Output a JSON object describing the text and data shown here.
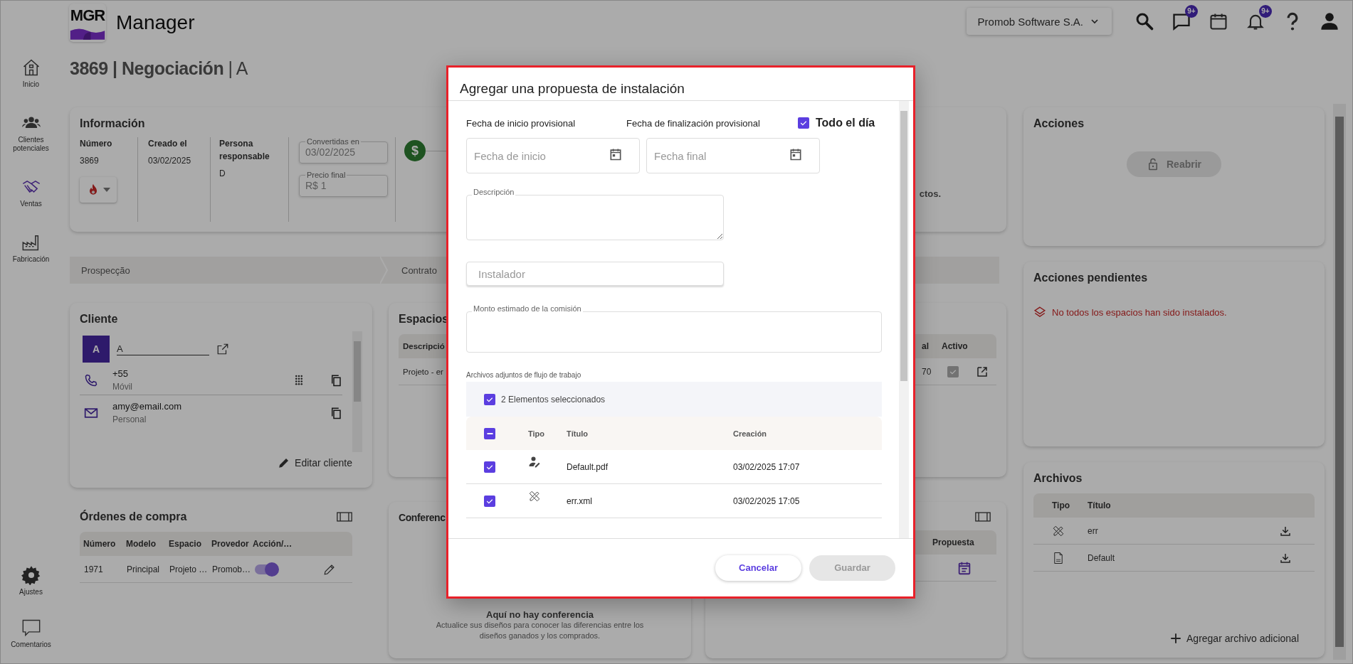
{
  "header": {
    "logo_text": "MGR",
    "app_name": "Manager",
    "company": "Promob Software S.A.",
    "icons": [
      {
        "kind": "search"
      },
      {
        "kind": "chat",
        "badge": "9+"
      },
      {
        "kind": "calendar"
      },
      {
        "kind": "bell",
        "badge": "9+"
      },
      {
        "kind": "help"
      },
      {
        "kind": "user"
      }
    ]
  },
  "sidebar": {
    "items": [
      {
        "label": "Inicio",
        "selected": false
      },
      {
        "label": "Clientes potenciales",
        "selected": false
      },
      {
        "label": "Ventas",
        "selected": true
      },
      {
        "label": "Fabricación",
        "selected": false
      }
    ],
    "bottom_items": [
      {
        "label": "Ajustes"
      },
      {
        "label": "Comentarios"
      }
    ]
  },
  "page_title": "**3869 | Negociación** | A",
  "info": {
    "title": "Información",
    "fields": [
      {
        "label": "Número",
        "value": "3869"
      },
      {
        "label": "Creado el",
        "value": "03/02/2025"
      },
      {
        "label": "Persona responsable",
        "value": "D"
      }
    ],
    "inputs": [
      {
        "label": "Convertidas en",
        "value": "03/02/2025"
      },
      {
        "label": "Precio final",
        "value": "R$ 1"
      }
    ],
    "status_symbol": "$",
    "note": "ctos."
  },
  "stages": [
    "Prospecção",
    "Contrato"
  ],
  "client": {
    "title": "Cliente",
    "avatar": "A",
    "name": "A",
    "contacts": [
      {
        "kind": "phone",
        "value": "+55",
        "type": "Móvil"
      },
      {
        "kind": "email",
        "value": "amy@email.com",
        "type": "Personal"
      }
    ],
    "edit_button": "Editar cliente"
  },
  "purchase_orders": {
    "title": "Órdenes de compra",
    "columns": [
      "Número",
      "Modelo",
      "Espacio",
      "Provedor",
      "Acción/…"
    ],
    "rows": [
      {
        "cells": [
          "1971",
          "Principal",
          "Projeto …",
          "Promob…"
        ],
        "action_on": true
      }
    ]
  },
  "spaces": {
    "title": "Espacios",
    "columns": [
      "Descripció",
      "al",
      "Activo"
    ],
    "rows": [
      {
        "cells": [
          "Projeto - er",
          "70"
        ],
        "active": true
      }
    ]
  },
  "conference": {
    "title": "Conferenc",
    "empty_title": "Aquí no hay conferencia",
    "empty_text": "Actualice sus diseños para conocer las diferencias entre los diseños ganados y los comprados."
  },
  "proposals": {
    "columns": [
      "Propuesta"
    ]
  },
  "actions": {
    "title": "Acciones",
    "reopen_button": {
      "label": "Reabrir",
      "disabled": true
    }
  },
  "pending": {
    "title": "Acciones pendientes",
    "items": [
      "No todos los espacios han sido instalados."
    ]
  },
  "files": {
    "title": "Archivos",
    "columns": [
      "Tipo",
      "Título"
    ],
    "rows": [
      {
        "kind": "drawing",
        "title": "err"
      },
      {
        "kind": "pdf",
        "title": "Default"
      }
    ],
    "add_button": "Agregar archivo adicional"
  },
  "dialog": {
    "title": "Agregar una propuesta de instalación",
    "start_label": "Fecha de inicio provisional",
    "end_label": "Fecha de finalización provisional",
    "all_day": {
      "label": "Todo el día",
      "checked": true
    },
    "start_field": {
      "placeholder": "Fecha de inicio"
    },
    "end_field": {
      "placeholder": "Fecha final"
    },
    "description": {
      "label": "Descripción"
    },
    "installer": {
      "placeholder": "Instalador"
    },
    "commission": {
      "label": "Monto estimado de la comisión"
    },
    "attachments": {
      "label": "Archivos adjuntos de flujo de trabajo",
      "selection_text": "2 Elementos seleccionados",
      "selection_checked": true,
      "header_checked": true,
      "header_indeterminate": true,
      "columns": [
        "Tipo",
        "Título",
        "Creación"
      ],
      "rows": [
        {
          "kind": "user",
          "title": "Default.pdf",
          "created": "03/02/2025 17:07",
          "checked": true
        },
        {
          "kind": "drawing",
          "title": "err.xml",
          "created": "03/02/2025 17:05",
          "checked": true
        }
      ]
    },
    "buttons": [
      {
        "label": "Cancelar",
        "kind": "secondary",
        "disabled": false
      },
      {
        "label": "Guardar",
        "kind": "primary",
        "disabled": true
      }
    ]
  }
}
